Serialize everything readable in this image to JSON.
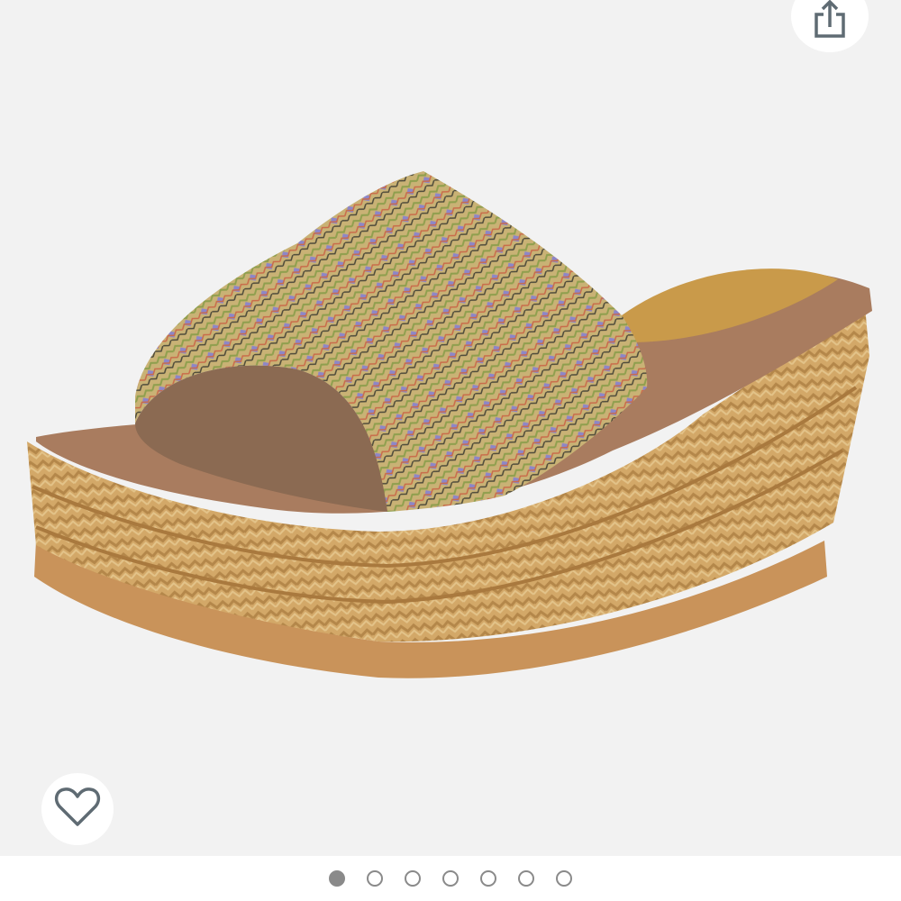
{
  "product": {
    "image_subject": "woven-espadrille-wedge-slide-sandal"
  },
  "share": {
    "icon": "share-icon"
  },
  "wishlist": {
    "icon": "heart-outline-icon"
  },
  "carousel": {
    "count": 7,
    "active_index": 0
  },
  "colors": {
    "background": "#f2f2f2",
    "dot": "#8a8a8a",
    "icon": "#5f6b73"
  }
}
